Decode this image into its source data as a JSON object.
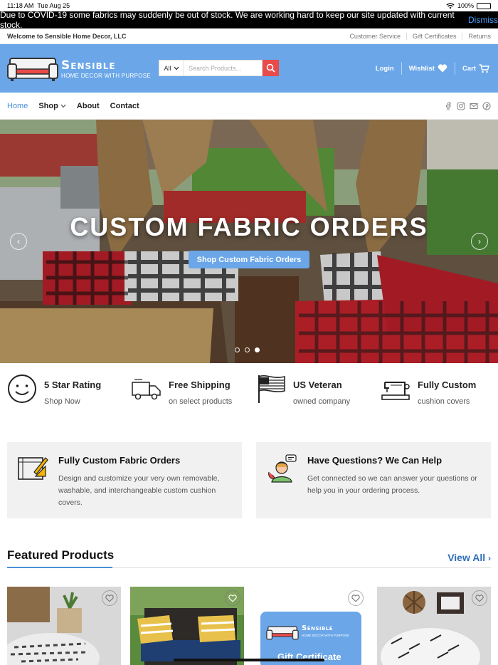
{
  "status": {
    "time": "11:18 AM",
    "date": "Tue Aug 25",
    "battery": "100%"
  },
  "notice": {
    "text": "Due to COVID-19 some fabrics may suddenly be out of stock. We are working hard to keep our site updated with current stock.",
    "dismiss": "Dismiss"
  },
  "topbar": {
    "welcome": "Welcome to Sensible Home Decor, LLC",
    "links": [
      "Customer Service",
      "Gift Certificates",
      "Returns"
    ]
  },
  "header": {
    "brand": "Sensible",
    "tagline": "HOME DECOR WITH PURPOSE",
    "search_category": "All",
    "search_placeholder": "Search Products...",
    "login": "Login",
    "wishlist": "Wishlist",
    "cart": "Cart"
  },
  "nav": {
    "items": [
      "Home",
      "Shop",
      "About",
      "Contact"
    ]
  },
  "hero": {
    "title": "CUSTOM FABRIC ORDERS",
    "button": "Shop Custom Fabric Orders",
    "active_slide": 3,
    "slides": 3
  },
  "features": [
    {
      "title": "5 Star Rating",
      "sub": "Shop Now",
      "icon": "smiley-icon"
    },
    {
      "title": "Free Shipping",
      "sub": "on select products",
      "icon": "truck-icon"
    },
    {
      "title": "US Veteran",
      "sub": "owned company",
      "icon": "flag-icon"
    },
    {
      "title": "Fully Custom",
      "sub": "cushion covers",
      "icon": "sewing-machine-icon"
    }
  ],
  "boxes": [
    {
      "title": "Fully Custom Fabric Orders",
      "body": "Design and customize your very own removable, washable, and interchangeable custom cushion covers."
    },
    {
      "title": "Have Questions? We Can Help",
      "body": "Get connected so we can answer your questions or help you in your ordering process."
    }
  ],
  "featured": {
    "title": "Featured Products",
    "view_all": "View All",
    "gift_title": "Gift Certificate"
  },
  "colors": {
    "brand_blue": "#6aa6e8",
    "search_red": "#e94a4a",
    "link_blue": "#4a90d9"
  }
}
